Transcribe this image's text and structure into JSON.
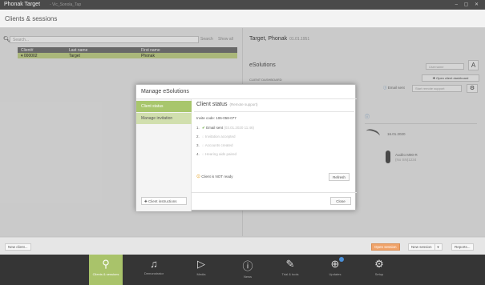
{
  "window": {
    "title": "Phonak Target",
    "subtitle": "-  Vic_Sonola_Tap",
    "controls": "– ▢ ✕"
  },
  "header": {
    "heading": "Clients & sessions"
  },
  "search": {
    "placeholder": "Search...",
    "search_label": "Search",
    "show_all_label": "Show all"
  },
  "clients_table": {
    "columns": [
      "Client#",
      "Last name",
      "First name"
    ],
    "rows": [
      {
        "id": "▾ 000002",
        "last": "Target",
        "first": "Phonak"
      }
    ]
  },
  "client_panel": {
    "name": "Target, Phonak",
    "meta": "01.01.1951",
    "esolutions_title": "eSolutions",
    "dashboard_label": "CLIENT DASHBOARD",
    "username_placeholder": "Username",
    "a_button": "A",
    "open_dashboard_label": "✚ Open client dashboard",
    "email_sent_label": "Email sent",
    "remote_support_placeholder": "Start remote support",
    "devices": [
      {
        "name": "",
        "date": "16.01.2020"
      },
      {
        "name": "Audéo M90-R",
        "date": "(No SN)1234"
      }
    ]
  },
  "dialog": {
    "title": "Manage eSolutions",
    "tabs": [
      {
        "label": "Client status",
        "active": true
      },
      {
        "label": "Manage invitation",
        "active": false
      }
    ],
    "client_instructions_label": "✚ Client instructions",
    "status_title": "Client status",
    "status_subtitle": "(Remote support)",
    "invite_code": "Invite code: 106-058-077",
    "steps": [
      {
        "num": "1.",
        "label": "Email sent",
        "detail": "(03.01.2020 11:46)",
        "done": true
      },
      {
        "num": "2.",
        "label": "Invitation accepted",
        "detail": "",
        "done": false
      },
      {
        "num": "3.",
        "label": "Accounts created",
        "detail": "",
        "done": false
      },
      {
        "num": "4.",
        "label": "Hearing aids paired",
        "detail": "",
        "done": false
      }
    ],
    "not_ready_text": "Client is NOT ready",
    "refresh_label": "Refresh",
    "close_label": "Close"
  },
  "actionbar": {
    "new_client_label": "New client...",
    "open_session_label": "Open session",
    "new_session_label": "New session",
    "reports_label": "Reports..."
  },
  "nav": {
    "items": [
      {
        "label": "Clients & sessions",
        "icon": "person-icon",
        "glyph": "⚲",
        "active": true
      },
      {
        "label": "Demonstrator",
        "icon": "headset-icon",
        "glyph": "♫",
        "active": false
      },
      {
        "label": "Media",
        "icon": "play-icon",
        "glyph": "▷",
        "active": false
      },
      {
        "label": "News",
        "icon": "info-icon",
        "glyph": "ⓘ",
        "active": false
      },
      {
        "label": "Trial & tools",
        "icon": "tools-icon",
        "glyph": "✎",
        "active": false
      },
      {
        "label": "Updates",
        "icon": "download-icon",
        "glyph": "⊕",
        "active": false
      },
      {
        "label": "Setup",
        "icon": "gear-icon",
        "glyph": "⚙",
        "active": false
      }
    ]
  },
  "colors": {
    "accent": "#a9c36a",
    "nav_bg": "#353535",
    "orange": "#f0a36a"
  }
}
